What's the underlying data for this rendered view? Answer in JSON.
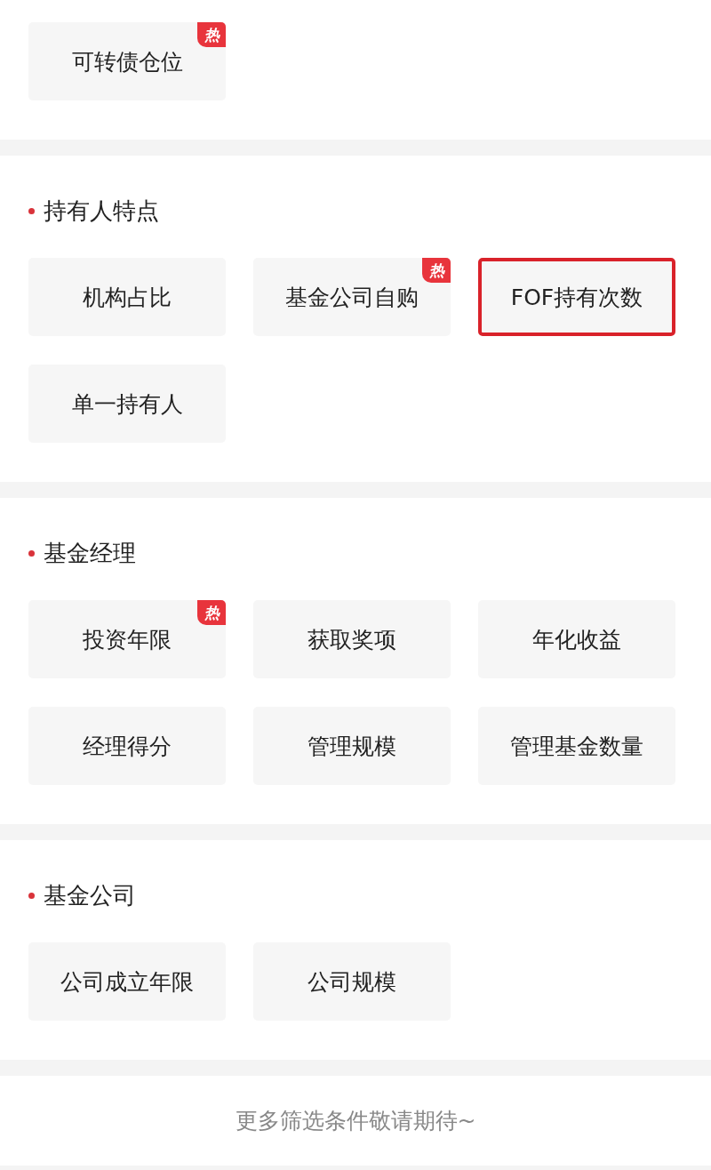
{
  "sections": [
    {
      "items": [
        {
          "label": "可转债仓位",
          "highlighted": false,
          "badge": "热"
        }
      ]
    },
    {
      "title": "持有人特点",
      "items": [
        {
          "label": "机构占比",
          "highlighted": false
        },
        {
          "label": "基金公司自购",
          "highlighted": false,
          "badge": "热"
        },
        {
          "label": "FOF持有次数",
          "highlighted": true
        },
        {
          "label": "单一持有人",
          "highlighted": false
        }
      ]
    },
    {
      "title": "基金经理",
      "items": [
        {
          "label": "投资年限",
          "highlighted": false,
          "badge": "热"
        },
        {
          "label": "获取奖项",
          "highlighted": false
        },
        {
          "label": "年化收益",
          "highlighted": false
        },
        {
          "label": "经理得分",
          "highlighted": false
        },
        {
          "label": "管理规模",
          "highlighted": false
        },
        {
          "label": "管理基金数量",
          "highlighted": false
        }
      ]
    },
    {
      "title": "基金公司",
      "items": [
        {
          "label": "公司成立年限",
          "highlighted": false
        },
        {
          "label": "公司规模",
          "highlighted": false
        }
      ]
    }
  ],
  "footer": "更多筛选条件敬请期待~"
}
